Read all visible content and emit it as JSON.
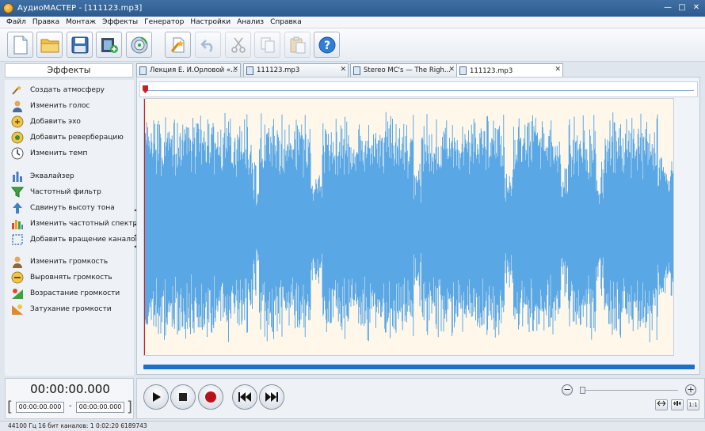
{
  "window": {
    "title": "АудиоМАСТЕР - [111123.mp3]",
    "minimize": "—",
    "maximize": "□",
    "close": "✕"
  },
  "menu": [
    "Файл",
    "Правка",
    "Монтаж",
    "Эффекты",
    "Генератор",
    "Настройки",
    "Анализ",
    "Справка"
  ],
  "toolbar": {
    "buttons": [
      {
        "name": "new-file",
        "icon": "new-document-icon",
        "enabled": true
      },
      {
        "name": "open-file",
        "icon": "folder-icon",
        "enabled": true
      },
      {
        "name": "save-file",
        "icon": "floppy-icon",
        "enabled": true
      },
      {
        "name": "add-video",
        "icon": "film-add-icon",
        "enabled": true
      },
      {
        "name": "record",
        "icon": "disc-record-icon",
        "enabled": true
      },
      {
        "name": "effects",
        "icon": "wand-icon",
        "enabled": true
      },
      {
        "name": "undo",
        "icon": "undo-icon",
        "enabled": false
      },
      {
        "name": "cut",
        "icon": "scissors-icon",
        "enabled": false
      },
      {
        "name": "copy",
        "icon": "copy-icon",
        "enabled": false
      },
      {
        "name": "paste",
        "icon": "paste-icon",
        "enabled": false
      },
      {
        "name": "help",
        "icon": "help-icon",
        "enabled": true
      }
    ]
  },
  "effects_panel": {
    "header": "Эффекты",
    "items": [
      {
        "label": "Создать атмосферу",
        "icon": "atmosphere-icon"
      },
      {
        "label": "Изменить голос",
        "icon": "voice-icon"
      },
      {
        "label": "Добавить эхо",
        "icon": "echo-icon"
      },
      {
        "label": "Добавить реверберацию",
        "icon": "reverb-icon"
      },
      {
        "label": "Изменить темп",
        "icon": "tempo-icon"
      },
      {
        "label": "Эквалайзер",
        "icon": "equalizer-icon"
      },
      {
        "label": "Частотный фильтр",
        "icon": "filter-icon"
      },
      {
        "label": "Сдвинуть высоту тона",
        "icon": "pitch-icon"
      },
      {
        "label": "Изменить частотный спектр",
        "icon": "spectrum-icon"
      },
      {
        "label": "Добавить вращение каналов",
        "icon": "rotate-channels-icon"
      },
      {
        "label": "Изменить громкость",
        "icon": "volume-icon"
      },
      {
        "label": "Выровнять громкость",
        "icon": "normalize-icon"
      },
      {
        "label": "Возрастание громкости",
        "icon": "fade-in-icon"
      },
      {
        "label": "Затухание громкости",
        "icon": "fade-out-icon"
      }
    ]
  },
  "tabs": [
    {
      "label": "Лекция Е. И.Орловой «...",
      "active": false
    },
    {
      "label": "111123.mp3",
      "active": false
    },
    {
      "label": "Stereo MC's — The Righ...",
      "active": false
    },
    {
      "label": "111123.mp3",
      "active": true
    }
  ],
  "time": {
    "current": "00:00:00.000",
    "selection_start": "00:00:00.000",
    "selection_end": "00:00:00.000",
    "dash": "-"
  },
  "zoom": {
    "minus": "−",
    "plus": "+",
    "fit_label": "1:1"
  },
  "status": "44100 Гц  16 бит  каналов: 1   0:02:20 6189743",
  "colors": {
    "waveform": "#5aa7e6",
    "wave_bg": "#fff8ea",
    "scrollbar": "#1f6ec8",
    "playhead": "#c62020"
  }
}
